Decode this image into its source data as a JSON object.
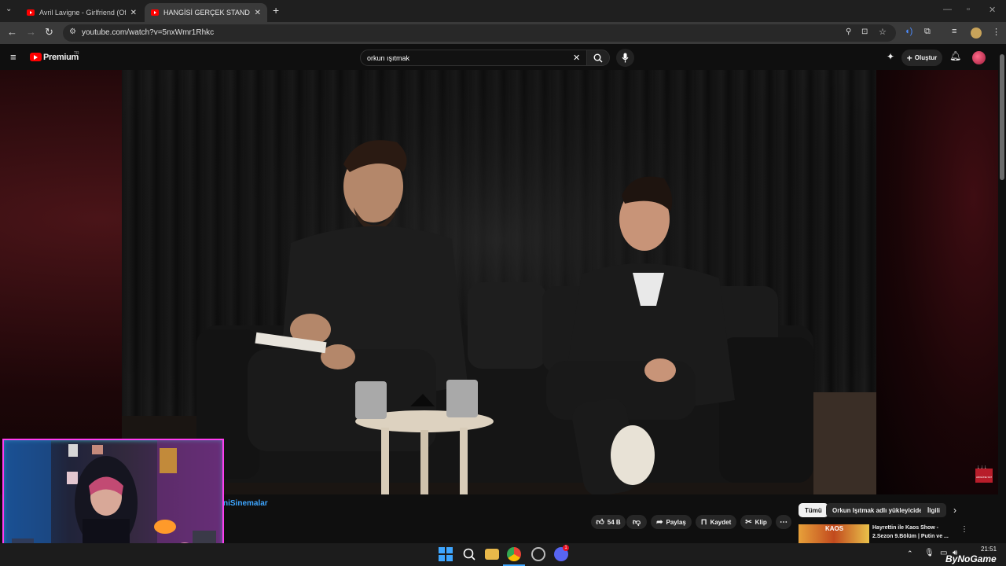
{
  "browser": {
    "tabs": [
      {
        "title": "Avril Lavigne - Girlfriend (Offici",
        "active": false
      },
      {
        "title": "HANGİSİ GERÇEK STAND-UP K",
        "active": true
      }
    ],
    "new_tab_symbol": "+",
    "url": "youtube.com/watch?v=5nxWmr1Rhkc"
  },
  "youtube": {
    "logo_text": "Premium",
    "region_badge": "TR",
    "search_value": "orkun ışıtmak",
    "create_label": "Oluştur"
  },
  "video": {
    "corner_badge": "ADIGÜNE SAT"
  },
  "below_video": {
    "channel_fragment": "niSinemalar",
    "like_count": "54 B",
    "share_label": "Paylaş",
    "save_label": "Kaydet",
    "clip_label": "Klip",
    "chips": [
      "Tümü",
      "Orkun Işıtmak adlı yükleyiciden",
      "İlgili"
    ],
    "rec_title_line1": "Hayrettin ile Kaos Show -",
    "rec_title_line2": "2.Sezon 9.Bölüm | Putin ve ...",
    "rec_thumb_text": "KAOS"
  },
  "taskbar": {
    "time": "21:51",
    "watermark": "ByNoGame",
    "discord_badge": "1"
  },
  "colors": {
    "yt_red": "#ff0000",
    "webcam_border": "#ff3df0",
    "channel_blue": "#3ea6ff"
  },
  "icons": [
    "tab-list-icon",
    "close-icon",
    "plus-icon",
    "back-icon",
    "forward-icon",
    "reload-icon",
    "site-info-icon",
    "zoom-icon",
    "install-icon",
    "star-icon",
    "extensions-icon",
    "profile-icon",
    "menu-icon",
    "search-icon",
    "mic-icon",
    "clear-icon",
    "create-icon",
    "notification-icon",
    "like-icon",
    "dislike-icon",
    "share-icon",
    "save-icon",
    "clip-icon",
    "more-icon",
    "chevron-right-icon",
    "windows-start-icon",
    "chrome-icon",
    "folder-icon",
    "discord-icon"
  ]
}
